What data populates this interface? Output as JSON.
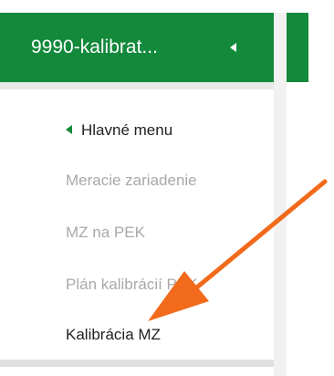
{
  "header": {
    "title": "9990-kalibrat...",
    "collapse_icon": "caret-left-icon",
    "accent_color": "#13893b"
  },
  "menu": {
    "back_label": "Hlavné menu",
    "back_icon": "caret-left-icon",
    "items": [
      {
        "label": "Meracie zariadenie",
        "state": "disabled"
      },
      {
        "label": "MZ na PEK",
        "state": "disabled"
      },
      {
        "label": "Plán kalibrácií PEK",
        "state": "disabled"
      },
      {
        "label": "Kalibrácia MZ",
        "state": "active"
      }
    ]
  },
  "annotation": {
    "icon": "arrow-icon",
    "color": "#f26a1b"
  }
}
